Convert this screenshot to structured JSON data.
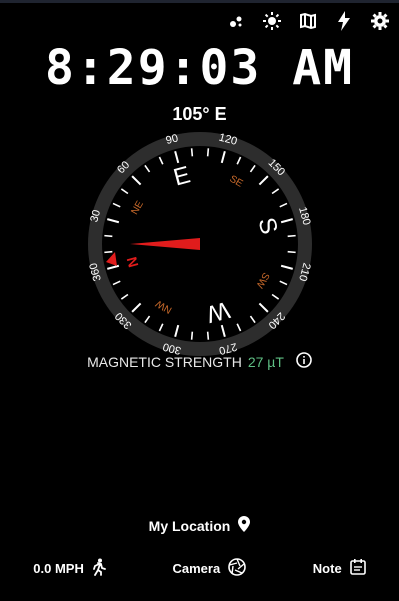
{
  "clock": {
    "time": "8:29:03 AM"
  },
  "heading": {
    "text": "105° E"
  },
  "compass": {
    "heading_deg": 105,
    "degree_labels": [
      "90",
      "120",
      "150",
      "180",
      "210",
      "240",
      "270",
      "300",
      "330",
      "360",
      "30",
      "60"
    ],
    "cardinal_labels": [
      "E",
      "S",
      "W",
      "N"
    ],
    "intercardinal_labels": [
      "SE",
      "SW",
      "NW",
      "NE"
    ],
    "colors": {
      "needle": "#e01c1c",
      "intercardinal": "#c96a2b",
      "ring": "#2d2d2d"
    }
  },
  "magnetic": {
    "label": "MAGNETIC STRENGTH",
    "value": "27 µT"
  },
  "location": {
    "label": "My Location"
  },
  "bottom": {
    "speed": "0.0 MPH",
    "camera": "Camera",
    "note": "Note"
  },
  "toolbar_icons": [
    "layers-icon",
    "brightness-icon",
    "map-icon",
    "flash-icon",
    "settings-icon"
  ]
}
